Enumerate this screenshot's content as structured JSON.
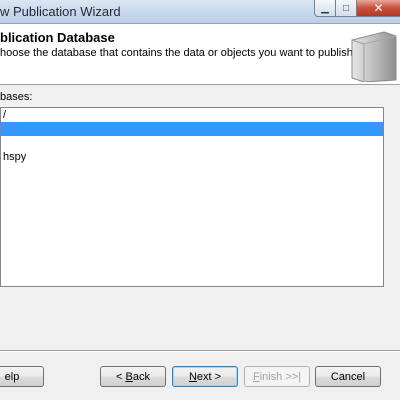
{
  "window": {
    "title": "w Publication Wizard",
    "controls": {
      "minimize_icon": "minimize-icon",
      "maximize_icon": "maximize-icon",
      "close_icon": "close-icon"
    }
  },
  "header": {
    "title": "blication Database",
    "subtitle": "hoose the database that contains the data or objects you want to publish."
  },
  "databases": {
    "label": "bases:",
    "items": [
      {
        "label": "/",
        "selected": false
      },
      {
        "label": "",
        "selected": true
      },
      {
        "label": "",
        "selected": false
      },
      {
        "label": "hspy",
        "selected": false
      }
    ]
  },
  "buttons": {
    "help": "elp",
    "back_prefix": "< ",
    "back_mnemonic": "B",
    "back_rest": "ack",
    "next_mnemonic": "N",
    "next_rest": "ext >",
    "finish_mnemonic": "F",
    "finish_rest": "inish >>|",
    "cancel": "Cancel"
  },
  "colors": {
    "selection": "#3399ff",
    "title_bar": "#c9d9ec",
    "close_button": "#c7503c"
  }
}
